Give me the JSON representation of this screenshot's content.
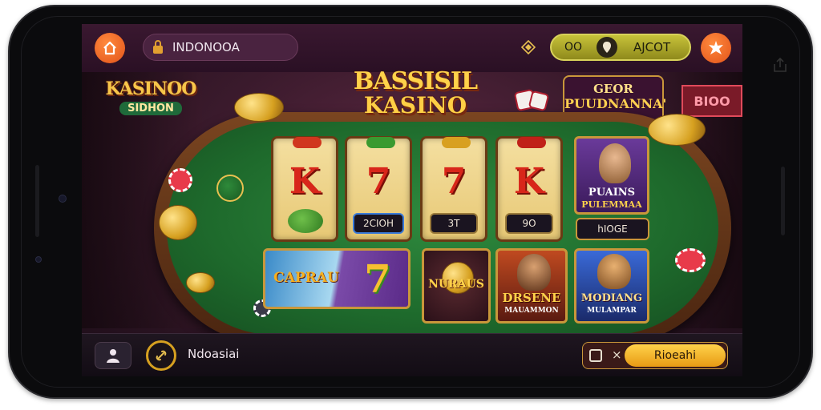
{
  "topbar": {
    "search_text": "INDONOOA",
    "jackpot_label": "OO",
    "jackpot_value": "AJCOT"
  },
  "logos": {
    "left_title": "KASINOO",
    "left_sub": "SIDHON",
    "center_line1": "BASSISIL",
    "center_line2": "KASINO",
    "promo_line1": "GEOR",
    "promo_line2": "PUUDNANNA'",
    "right_sign": "BIOO"
  },
  "reels": [
    {
      "symbol": "K",
      "tag": ""
    },
    {
      "symbol": "7",
      "tag": "2CIOH"
    },
    {
      "symbol": "7",
      "tag": "3T"
    },
    {
      "symbol": "K",
      "tag": "9O"
    }
  ],
  "cards": {
    "top_right": {
      "title": "PUAINS",
      "sub": "PULEMMAA",
      "button": "hIOGE"
    },
    "bottom": [
      {
        "title": "CAPRAU"
      },
      {
        "title": "NURAUS"
      },
      {
        "title": "DRSENE",
        "sub": "MAUAMMON"
      },
      {
        "title": "MODIANG",
        "sub": "MULAMPAR"
      }
    ]
  },
  "bottombar": {
    "label": "Ndoasiai",
    "action_label": "Rioeahi"
  },
  "colors": {
    "accent_orange": "#e2531a",
    "felt_green": "#1e6a2c",
    "gold": "#ffd24a",
    "jackpot_olive": "#c7c23a"
  }
}
